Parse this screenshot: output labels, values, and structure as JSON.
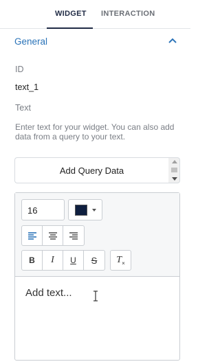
{
  "tabs": [
    {
      "label": "WIDGET",
      "active": true
    },
    {
      "label": "INTERACTION",
      "active": false
    }
  ],
  "section": {
    "title": "General",
    "expanded": true
  },
  "fields": {
    "id_label": "ID",
    "id_value": "text_1",
    "text_label": "Text",
    "help_text": "Enter text for your widget. You can also add data from a query to your text."
  },
  "query_button": {
    "label": "Add Query Data"
  },
  "editor": {
    "font_size": "16",
    "text_color": "#0f1f3f",
    "align_buttons": [
      "align-left-icon",
      "align-center-icon",
      "align-right-icon"
    ],
    "active_align": "align-left-icon",
    "format": {
      "bold": "B",
      "italic": "I",
      "underline": "U",
      "strike": "S",
      "clear": "T"
    },
    "placeholder": "Add text..."
  }
}
